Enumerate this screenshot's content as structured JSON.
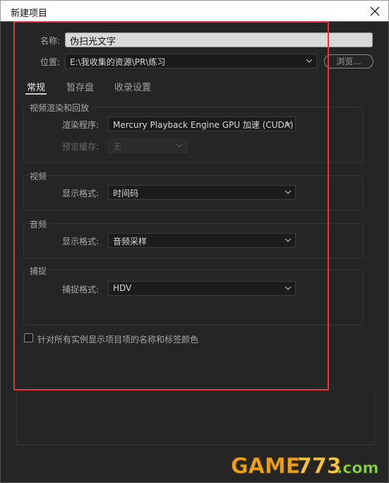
{
  "window": {
    "title": "新建项目",
    "close_icon": "close-icon"
  },
  "form": {
    "name_label": "名称:",
    "name_value": "伪扫光文字",
    "location_label": "位置:",
    "location_value": "E:\\我收集的资源\\PR\\练习",
    "browse_label": "浏览..."
  },
  "tabs": [
    {
      "label": "常规",
      "active": true
    },
    {
      "label": "暂存盘",
      "active": false
    },
    {
      "label": "收录设置",
      "active": false
    }
  ],
  "video_render": {
    "title": "视频渲染和回放",
    "renderer_label": "渲染程序:",
    "renderer_value": "Mercury Playback Engine GPU 加速 (CUDA)",
    "preview_cache_label": "预览缓存:",
    "preview_cache_value": "无"
  },
  "video": {
    "title": "视频",
    "format_label": "显示格式:",
    "format_value": "时间码"
  },
  "audio": {
    "title": "音频",
    "format_label": "显示格式:",
    "format_value": "音频采样"
  },
  "capture": {
    "title": "捕捉",
    "format_label": "捕捉格式:",
    "format_value": "HDV"
  },
  "option": {
    "label": "针对所有实例显示项目项的名称和标签颜色",
    "checked": false
  },
  "watermark": {
    "text": "GAME773.com"
  },
  "colors": {
    "accent_red": "#e0383a",
    "background": "#252525",
    "input_light": "#d8d8d8"
  }
}
